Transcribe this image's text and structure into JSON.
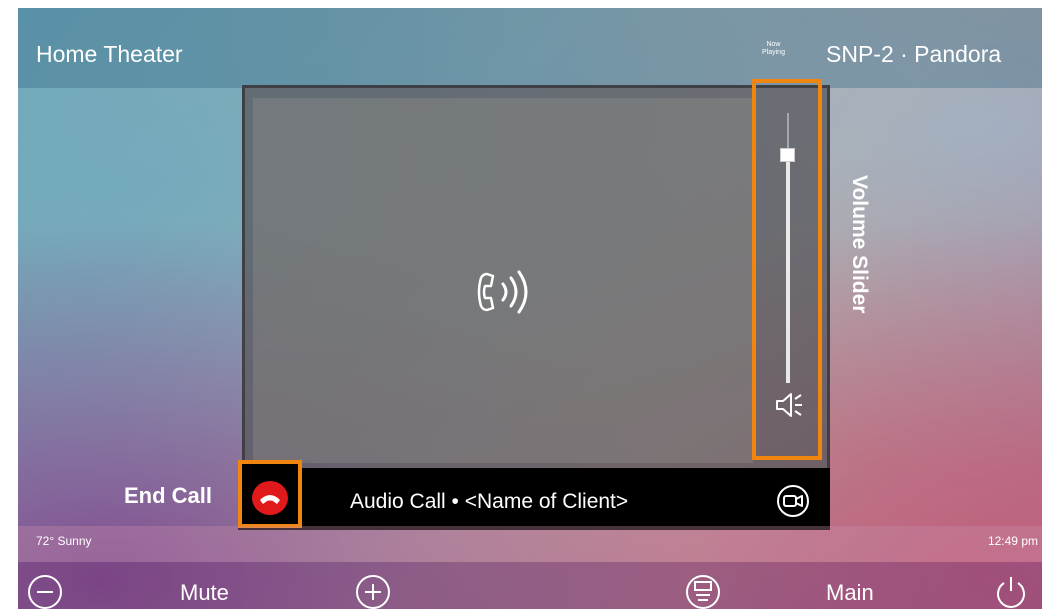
{
  "header": {
    "title": "Home Theater",
    "now_playing_line1": "Now",
    "now_playing_line2": "Playing",
    "source": "SNP-2 · Pandora"
  },
  "call": {
    "icon": "phone-ringing-icon",
    "label": "Audio Call • <Name of Client>",
    "end_icon": "end-call-icon",
    "video_icon": "video-camera-icon"
  },
  "volume": {
    "icon": "speaker-icon",
    "level": 0.85
  },
  "annotations": {
    "volume_slider": "Volume Slider",
    "end_call": "End Call",
    "highlight_color": "#f0850f"
  },
  "status": {
    "weather": "72° Sunny",
    "time": "12:49 pm"
  },
  "bottom_bar": {
    "volume_down_icon": "minus-circle-icon",
    "mute_label": "Mute",
    "volume_up_icon": "plus-circle-icon",
    "menu_icon": "menu-circle-icon",
    "main_label": "Main",
    "power_icon": "power-icon"
  }
}
